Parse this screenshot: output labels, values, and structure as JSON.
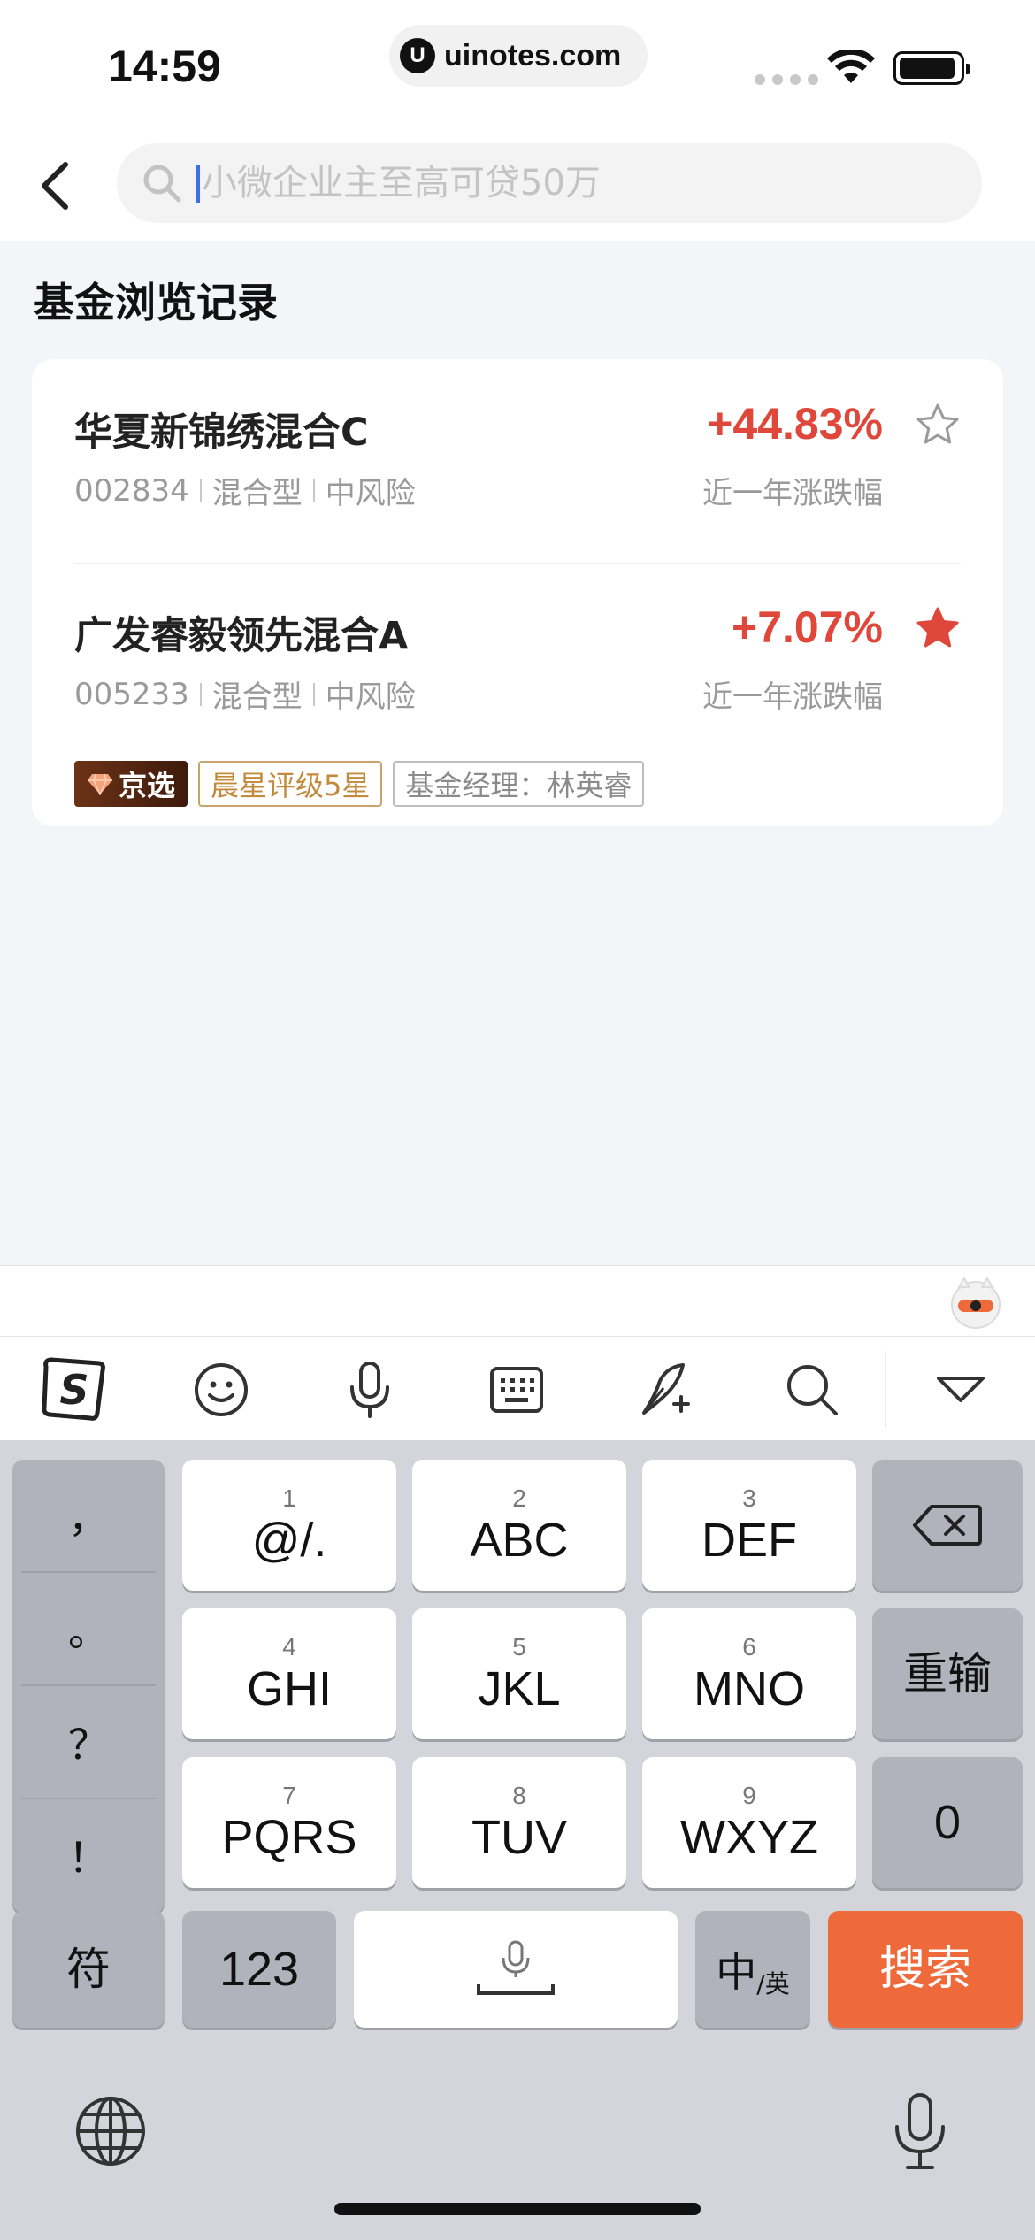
{
  "status_bar": {
    "time": "14:59",
    "url": "uinotes.com",
    "url_logo": "U"
  },
  "search": {
    "placeholder": "小微企业主至高可贷50万",
    "icon": "search-icon",
    "back_icon": "chevron-left-icon"
  },
  "section": {
    "title": "基金浏览记录"
  },
  "funds": [
    {
      "name": "华夏新锦绣混合C",
      "code": "002834",
      "type": "混合型",
      "risk": "中风险",
      "rate": "+44.83%",
      "rate_label": "近一年涨跌幅",
      "favorited": false
    },
    {
      "name": "广发睿毅领先混合A",
      "code": "005233",
      "type": "混合型",
      "risk": "中风险",
      "rate": "+7.07%",
      "rate_label": "近一年涨跌幅",
      "favorited": true,
      "tags": {
        "jingxuan": "京选",
        "rating": "晨星评级5星",
        "manager": "基金经理：林英睿"
      }
    }
  ],
  "colors": {
    "rate_red": "#e0473b",
    "star_red": "#e0473b",
    "search_key": "#ef6a3a",
    "keyboard_bg": "#d3d5db"
  },
  "keyboard": {
    "toolbar_icons": [
      "sogou-logo-icon",
      "emoji-icon",
      "microphone-icon",
      "keyboard-icon",
      "handwriting-icon",
      "search-icon",
      "collapse-icon"
    ],
    "punctuation": [
      "，",
      "。",
      "？",
      "！"
    ],
    "keys": [
      {
        "num": "1",
        "label": "@/."
      },
      {
        "num": "2",
        "label": "ABC"
      },
      {
        "num": "3",
        "label": "DEF"
      },
      {
        "num": "4",
        "label": "GHI"
      },
      {
        "num": "5",
        "label": "JKL"
      },
      {
        "num": "6",
        "label": "MNO"
      },
      {
        "num": "7",
        "label": "PQRS"
      },
      {
        "num": "8",
        "label": "TUV"
      },
      {
        "num": "9",
        "label": "WXYZ"
      }
    ],
    "retype": "重输",
    "zero": "0",
    "symbol": "符",
    "numbers": "123",
    "lang_main": "中",
    "lang_sub": "/英",
    "search": "搜索"
  }
}
